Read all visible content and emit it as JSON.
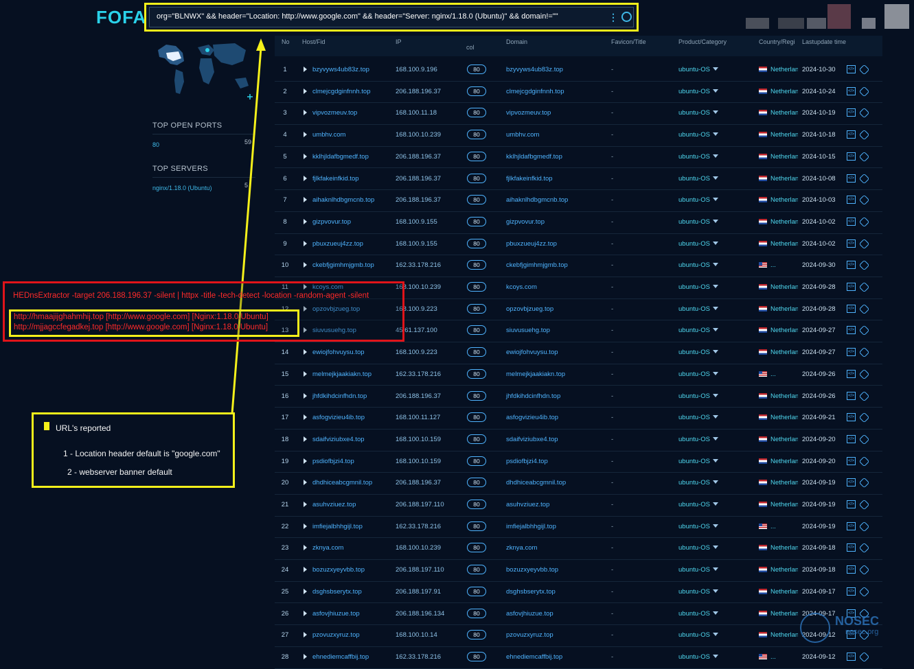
{
  "app": {
    "logo": "FOFA",
    "query": "org=\"BLNWX\" && header=\"Location: http://www.google.com\" && header=\"Server: nginx/1.18.0 (Ubuntu)\" && domain!=\"\""
  },
  "sidebar": {
    "ports_title": "TOP OPEN PORTS",
    "ports": [
      {
        "label": "80",
        "count": "59"
      }
    ],
    "servers_title": "TOP SERVERS",
    "servers": [
      {
        "label": "nginx/1.18.0 (Ubuntu)",
        "count": "5"
      }
    ]
  },
  "table": {
    "headers": [
      "No",
      "Host/Fid",
      "IP",
      "col",
      "Domain",
      "Favicon/Title",
      "Product/Category",
      "Country/Regi",
      "Lastupdate time"
    ],
    "rows": [
      {
        "no": "1",
        "host": "bzyvyws4ub83z.top",
        "ip": "168.100.9.196",
        "port": "80",
        "domain": "bzyvyws4ub83z.top",
        "fav": "-",
        "product": "ubuntu-OS",
        "flag": "nl",
        "country": "Netherlands",
        "date": "2024-10-30"
      },
      {
        "no": "2",
        "host": "clmejcgdginfnnh.top",
        "ip": "206.188.196.37",
        "port": "80",
        "domain": "clmejcgdginfnnh.top",
        "fav": "-",
        "product": "ubuntu-OS",
        "flag": "nl",
        "country": "Netherlands",
        "date": "2024-10-24"
      },
      {
        "no": "3",
        "host": "vipvozmeuv.top",
        "ip": "168.100.11.18",
        "port": "80",
        "domain": "vipvozmeuv.top",
        "fav": "-",
        "product": "ubuntu-OS",
        "flag": "nl",
        "country": "Netherlands",
        "date": "2024-10-19"
      },
      {
        "no": "4",
        "host": "umbhv.com",
        "ip": "168.100.10.239",
        "port": "80",
        "domain": "umbhv.com",
        "fav": "-",
        "product": "ubuntu-OS",
        "flag": "nl",
        "country": "Netherlands",
        "date": "2024-10-18"
      },
      {
        "no": "5",
        "host": "kklhjldafbgmedf.top",
        "ip": "206.188.196.37",
        "port": "80",
        "domain": "kklhjldafbgmedf.top",
        "fav": "-",
        "product": "ubuntu-OS",
        "flag": "nl",
        "country": "Netherlands",
        "date": "2024-10-15"
      },
      {
        "no": "6",
        "host": "fjlkfakeinfkid.top",
        "ip": "206.188.196.37",
        "port": "80",
        "domain": "fjlkfakeinfkid.top",
        "fav": "-",
        "product": "ubuntu-OS",
        "flag": "nl",
        "country": "Netherlands",
        "date": "2024-10-08"
      },
      {
        "no": "7",
        "host": "aihaknlhdbgmcnb.top",
        "ip": "206.188.196.37",
        "port": "80",
        "domain": "aihaknlhdbgmcnb.top",
        "fav": "-",
        "product": "ubuntu-OS",
        "flag": "nl",
        "country": "Netherlands",
        "date": "2024-10-03"
      },
      {
        "no": "8",
        "host": "gizpvovur.top",
        "ip": "168.100.9.155",
        "port": "80",
        "domain": "gizpvovur.top",
        "fav": "-",
        "product": "ubuntu-OS",
        "flag": "nl",
        "country": "Netherlands",
        "date": "2024-10-02"
      },
      {
        "no": "9",
        "host": "pbuxzueuj4zz.top",
        "ip": "168.100.9.155",
        "port": "80",
        "domain": "pbuxzueuj4zz.top",
        "fav": "-",
        "product": "ubuntu-OS",
        "flag": "nl",
        "country": "Netherlands",
        "date": "2024-10-02"
      },
      {
        "no": "10",
        "host": "ckebfjgimhmjgmb.top",
        "ip": "162.33.178.216",
        "port": "80",
        "domain": "ckebfjgimhmjgmb.top",
        "fav": "-",
        "product": "ubuntu-OS",
        "flag": "us",
        "country": "...",
        "date": "2024-09-30"
      },
      {
        "no": "11",
        "host": "kcoys.com",
        "ip": "168.100.10.239",
        "port": "80",
        "domain": "kcoys.com",
        "fav": "-",
        "product": "ubuntu-OS",
        "flag": "nl",
        "country": "Netherlands",
        "date": "2024-09-28"
      },
      {
        "no": "12",
        "host": "opzovbjzueg.top",
        "ip": "168.100.9.223",
        "port": "80",
        "domain": "opzovbjzueg.top",
        "fav": "-",
        "product": "ubuntu-OS",
        "flag": "nl",
        "country": "Netherlands",
        "date": "2024-09-28"
      },
      {
        "no": "13",
        "host": "siuvusuehg.top",
        "ip": "45.61.137.100",
        "port": "80",
        "domain": "siuvusuehg.top",
        "fav": "-",
        "product": "ubuntu-OS",
        "flag": "nl",
        "country": "Netherlands",
        "date": "2024-09-27"
      },
      {
        "no": "14",
        "host": "ewiojfohvuysu.top",
        "ip": "168.100.9.223",
        "port": "80",
        "domain": "ewiojfohvuysu.top",
        "fav": "-",
        "product": "ubuntu-OS",
        "flag": "nl",
        "country": "Netherlands",
        "date": "2024-09-27"
      },
      {
        "no": "15",
        "host": "melmejkjaakiakn.top",
        "ip": "162.33.178.216",
        "port": "80",
        "domain": "melmejkjaakiakn.top",
        "fav": "-",
        "product": "ubuntu-OS",
        "flag": "us",
        "country": "...",
        "date": "2024-09-26"
      },
      {
        "no": "16",
        "host": "jhfdkihdcinfhdn.top",
        "ip": "206.188.196.37",
        "port": "80",
        "domain": "jhfdkihdcinfhdn.top",
        "fav": "-",
        "product": "ubuntu-OS",
        "flag": "nl",
        "country": "Netherlands",
        "date": "2024-09-26"
      },
      {
        "no": "17",
        "host": "asfogvizieu4ib.top",
        "ip": "168.100.11.127",
        "port": "80",
        "domain": "asfogvizieu4ib.top",
        "fav": "-",
        "product": "ubuntu-OS",
        "flag": "nl",
        "country": "Netherlands",
        "date": "2024-09-21"
      },
      {
        "no": "18",
        "host": "sdaifviziubxe4.top",
        "ip": "168.100.10.159",
        "port": "80",
        "domain": "sdaifviziubxe4.top",
        "fav": "-",
        "product": "ubuntu-OS",
        "flag": "nl",
        "country": "Netherlands",
        "date": "2024-09-20"
      },
      {
        "no": "19",
        "host": "psdiofbjzi4.top",
        "ip": "168.100.10.159",
        "port": "80",
        "domain": "psdiofbjzi4.top",
        "fav": "-",
        "product": "ubuntu-OS",
        "flag": "nl",
        "country": "Netherlands",
        "date": "2024-09-20"
      },
      {
        "no": "20",
        "host": "dhdhiceabcgmnil.top",
        "ip": "206.188.196.37",
        "port": "80",
        "domain": "dhdhiceabcgmnil.top",
        "fav": "-",
        "product": "ubuntu-OS",
        "flag": "nl",
        "country": "Netherlands",
        "date": "2024-09-19"
      },
      {
        "no": "21",
        "host": "asuhvziuez.top",
        "ip": "206.188.197.110",
        "port": "80",
        "domain": "asuhvziuez.top",
        "fav": "-",
        "product": "ubuntu-OS",
        "flag": "nl",
        "country": "Netherlands",
        "date": "2024-09-19"
      },
      {
        "no": "22",
        "host": "imfiejalbhhgijl.top",
        "ip": "162.33.178.216",
        "port": "80",
        "domain": "imfiejalbhhgijl.top",
        "fav": "-",
        "product": "ubuntu-OS",
        "flag": "us",
        "country": "...",
        "date": "2024-09-19"
      },
      {
        "no": "23",
        "host": "zknya.com",
        "ip": "168.100.10.239",
        "port": "80",
        "domain": "zknya.com",
        "fav": "-",
        "product": "ubuntu-OS",
        "flag": "nl",
        "country": "Netherlands",
        "date": "2024-09-18"
      },
      {
        "no": "24",
        "host": "bozuzxyeyvbb.top",
        "ip": "206.188.197.110",
        "port": "80",
        "domain": "bozuzxyeyvbb.top",
        "fav": "-",
        "product": "ubuntu-OS",
        "flag": "nl",
        "country": "Netherlands",
        "date": "2024-09-18"
      },
      {
        "no": "25",
        "host": "dsghsbserytx.top",
        "ip": "206.188.197.91",
        "port": "80",
        "domain": "dsghsbserytx.top",
        "fav": "-",
        "product": "ubuntu-OS",
        "flag": "nl",
        "country": "Netherlands",
        "date": "2024-09-17"
      },
      {
        "no": "26",
        "host": "asfovjhiuzue.top",
        "ip": "206.188.196.134",
        "port": "80",
        "domain": "asfovjhiuzue.top",
        "fav": "-",
        "product": "ubuntu-OS",
        "flag": "nl",
        "country": "Netherlands",
        "date": "2024-09-17"
      },
      {
        "no": "27",
        "host": "pzovuzxyruz.top",
        "ip": "168.100.10.14",
        "port": "80",
        "domain": "pzovuzxyruz.top",
        "fav": "-",
        "product": "ubuntu-OS",
        "flag": "nl",
        "country": "Netherlands",
        "date": "2024-09-12"
      },
      {
        "no": "28",
        "host": "ehnediemcaffbij.top",
        "ip": "162.33.178.216",
        "port": "80",
        "domain": "ehnediemcaffbij.top",
        "fav": "-",
        "product": "ubuntu-OS",
        "flag": "us",
        "country": "...",
        "date": "2024-09-12"
      }
    ]
  },
  "overlay": {
    "command": "HEDnsExtractor -target 206.188.196.37 -silent |  httpx -title -tech-detect -location -random-agent -silent",
    "results": [
      "http://hmaajijghahmhij.top [http://www.google.com] [Nginx:1.18.0,Ubuntu]",
      "http://mjjagccfegadkej.top [http://www.google.com] [Nginx:1.18.0,Ubuntu]"
    ]
  },
  "note": {
    "title": "URL's reported",
    "line1": "1 - Location header default is \"google.com\"",
    "line2": "2 - webserver banner default"
  },
  "watermark": {
    "text": "NOSEC",
    "sub": "nosec.org"
  },
  "colors": {
    "background": "#061021",
    "accent": "#2ad2ea",
    "link": "#4fb4ff",
    "highlight": "#f5f01a",
    "alert": "#e0141a"
  }
}
